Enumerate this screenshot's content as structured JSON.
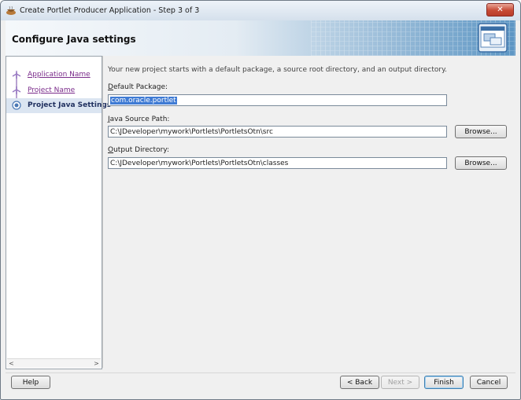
{
  "window": {
    "title": "Create Portlet Producer Application - Step 3 of 3",
    "close_glyph": "✕"
  },
  "header": {
    "title": "Configure Java settings",
    "icon": "wizard-window-icon"
  },
  "nav": {
    "items": [
      {
        "label": "Application Name",
        "state": "visited"
      },
      {
        "label": "Project Name",
        "state": "visited"
      },
      {
        "label": "Project Java Settings",
        "state": "current"
      }
    ],
    "scroll_left": "<",
    "scroll_right": ">"
  },
  "content": {
    "intro": "Your new project starts with a default package, a source root directory, and an output directory.",
    "default_package": {
      "label_mnemonic": "D",
      "label_rest": "efault Package:",
      "value": "com.oracle.portlet"
    },
    "source_path": {
      "label_mnemonic": "J",
      "label_rest": "ava Source Path:",
      "value": "C:\\JDeveloper\\mywork\\Portlets\\PortletsOtn\\src",
      "browse": "Browse..."
    },
    "output_dir": {
      "label_mnemonic": "O",
      "label_rest": "utput Directory:",
      "value": "C:\\JDeveloper\\mywork\\Portlets\\PortletsOtn\\classes",
      "browse": "Browse..."
    }
  },
  "footer": {
    "help": "Help",
    "back": "< Back",
    "next": "Next >",
    "finish": "Finish",
    "cancel": "Cancel"
  },
  "colors": {
    "accent": "#3f7bd4",
    "link_visited": "#7a2b8a",
    "close_button": "#c74a35"
  }
}
